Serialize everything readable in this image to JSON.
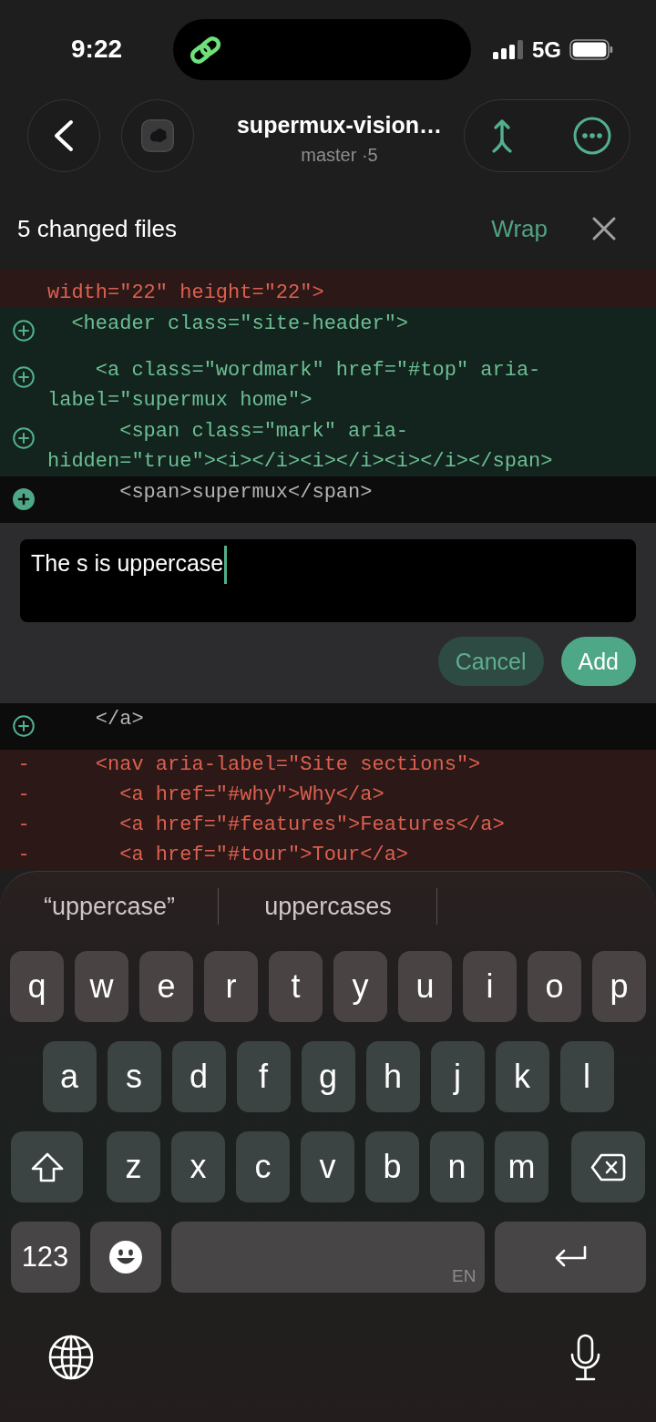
{
  "status_bar": {
    "time": "9:22",
    "network": "5G"
  },
  "header": {
    "title": "supermux-vision…",
    "subtitle": "master ·5"
  },
  "files_bar": {
    "title": "5 changed files",
    "wrap": "Wrap"
  },
  "diff": {
    "lines_before": [
      {
        "kind": "removed",
        "text": "width=\"22\" height=\"22\">"
      },
      {
        "kind": "added",
        "text": "  <header class=\"site-header\">",
        "highlighted": false,
        "selected": false
      },
      {
        "kind": "added",
        "text": "    <a class=\"wordmark\" href=\"#top\" aria-label=\"supermux home\">",
        "highlighted": false,
        "selected": false
      },
      {
        "kind": "added",
        "text": "      <span class=\"mark\" aria-hidden=\"true\"><i></i><i></i><i></i></span>",
        "highlighted": false,
        "selected": false
      },
      {
        "kind": "added",
        "text": "      <span>supermux</span>",
        "highlighted": true,
        "selected": true
      }
    ],
    "comment": {
      "value": "The s is uppercase",
      "cancel": "Cancel",
      "add": "Add"
    },
    "lines_after": [
      {
        "kind": "added",
        "text": "    </a>",
        "highlighted": true,
        "selected": false
      },
      {
        "kind": "removed",
        "marker": "-",
        "text": "    <nav aria-label=\"Site sections\">"
      },
      {
        "kind": "removed",
        "marker": "-",
        "text": "      <a href=\"#why\">Why</a>"
      },
      {
        "kind": "removed",
        "marker": "-",
        "text": "      <a href=\"#features\">Features</a>"
      },
      {
        "kind": "removed",
        "marker": "-",
        "text": "      <a href=\"#tour\">Tour</a>"
      }
    ]
  },
  "keyboard": {
    "suggestions": [
      "“uppercase”",
      "uppercases"
    ],
    "letter_rows": [
      [
        {
          "kind": "letter",
          "label": "q"
        },
        {
          "kind": "letter",
          "label": "w"
        },
        {
          "kind": "letter",
          "label": "e"
        },
        {
          "kind": "letter",
          "label": "r"
        },
        {
          "kind": "letter",
          "label": "t"
        },
        {
          "kind": "letter",
          "label": "y"
        },
        {
          "kind": "letter",
          "label": "u"
        },
        {
          "kind": "letter",
          "label": "i"
        },
        {
          "kind": "letter",
          "label": "o"
        },
        {
          "kind": "letter",
          "label": "p"
        }
      ],
      [
        {
          "kind": "letter",
          "label": "a"
        },
        {
          "kind": "letter",
          "label": "s"
        },
        {
          "kind": "letter",
          "label": "d"
        },
        {
          "kind": "letter",
          "label": "f"
        },
        {
          "kind": "letter",
          "label": "g"
        },
        {
          "kind": "letter",
          "label": "h"
        },
        {
          "kind": "letter",
          "label": "j"
        },
        {
          "kind": "letter",
          "label": "k"
        },
        {
          "kind": "letter",
          "label": "l"
        }
      ],
      [
        {
          "kind": "shift"
        },
        {
          "kind": "letter",
          "label": "z"
        },
        {
          "kind": "letter",
          "label": "x"
        },
        {
          "kind": "letter",
          "label": "c"
        },
        {
          "kind": "letter",
          "label": "v"
        },
        {
          "kind": "letter",
          "label": "b"
        },
        {
          "kind": "letter",
          "label": "n"
        },
        {
          "kind": "letter",
          "label": "m"
        },
        {
          "kind": "delete"
        }
      ]
    ],
    "function_row": [
      {
        "kind": "numbers",
        "label": "123"
      },
      {
        "kind": "emoji"
      },
      {
        "kind": "space",
        "label": "EN"
      },
      {
        "kind": "return"
      }
    ]
  }
}
